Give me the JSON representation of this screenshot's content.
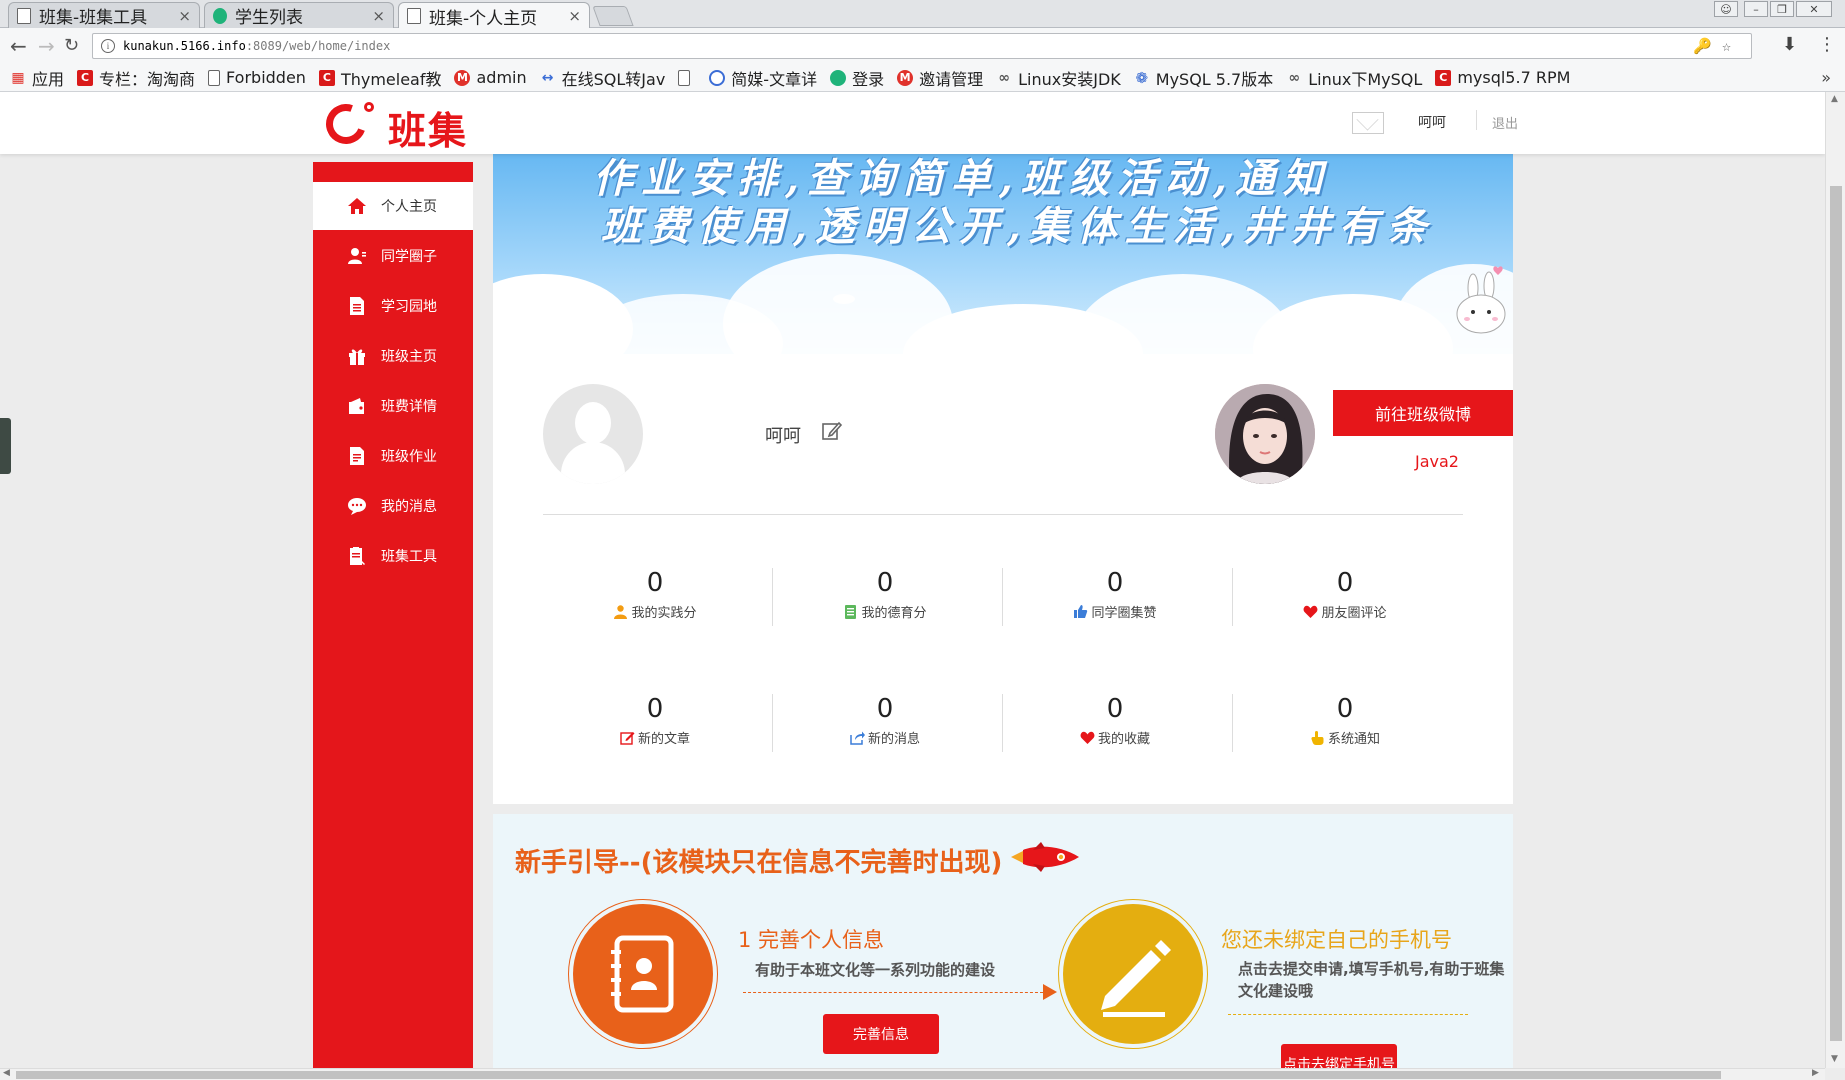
{
  "browser": {
    "tabs": [
      {
        "title": "班集-班集工具",
        "close": "×",
        "active": false
      },
      {
        "title": "学生列表",
        "close": "×",
        "active": false
      },
      {
        "title": "班集-个人主页",
        "close": "×",
        "active": true
      }
    ],
    "url_host": "kunakun.5166.info",
    "url_path": ":8089/web/home/index",
    "bookmarks": [
      {
        "label": "应用",
        "icon": "apps-grid-icon"
      },
      {
        "label": "专栏：淘淘商",
        "icon": "csdn-icon"
      },
      {
        "label": "Forbidden",
        "icon": "page-icon"
      },
      {
        "label": "Thymeleaf教",
        "icon": "csdn-icon"
      },
      {
        "label": "admin",
        "icon": "m-icon"
      },
      {
        "label": "在线SQL转Jav",
        "icon": "code-icon"
      },
      {
        "label": "",
        "icon": "page-icon"
      },
      {
        "label": "简媒-文章详",
        "icon": "blue-icon"
      },
      {
        "label": "登录",
        "icon": "vue-icon"
      },
      {
        "label": "邀请管理",
        "icon": "m-icon"
      },
      {
        "label": "Linux安装JDK",
        "icon": "link-icon"
      },
      {
        "label": "MySQL 5.7版本",
        "icon": "baidu-paw-icon"
      },
      {
        "label": "Linux下MySQL",
        "icon": "link-icon"
      },
      {
        "label": "mysql5.7 RPM",
        "icon": "csdn-icon"
      }
    ],
    "bookmarks_more": "»"
  },
  "header": {
    "logo_text": "班集",
    "username": "呵呵",
    "logout": "退出"
  },
  "sidebar": {
    "items": [
      {
        "label": "个人主页",
        "icon": "home-icon",
        "active": true
      },
      {
        "label": "同学圈子",
        "icon": "user-circle-icon",
        "active": false
      },
      {
        "label": "学习园地",
        "icon": "document-icon",
        "active": false
      },
      {
        "label": "班级主页",
        "icon": "gift-icon",
        "active": false
      },
      {
        "label": "班费详情",
        "icon": "wallet-icon",
        "active": false
      },
      {
        "label": "班级作业",
        "icon": "homework-icon",
        "active": false
      },
      {
        "label": "我的消息",
        "icon": "chat-bubble-icon",
        "active": false
      },
      {
        "label": "班集工具",
        "icon": "tools-icon",
        "active": false
      }
    ]
  },
  "banner": {
    "line1": "作业安排,查询简单,班级活动,通知",
    "line2": "班费使用,透明公开,集体生活,井井有条"
  },
  "profile": {
    "username": "呵呵",
    "weibo_button": "前往班级微博",
    "class_name": "Java2"
  },
  "stats": [
    {
      "value": "0",
      "label": "我的实践分",
      "icon": "person-icon",
      "color": "#f39c12"
    },
    {
      "value": "0",
      "label": "我的德育分",
      "icon": "doc-list-icon",
      "color": "#5cb85c"
    },
    {
      "value": "0",
      "label": "同学圈集赞",
      "icon": "thumbs-up-icon",
      "color": "#3b7dd8"
    },
    {
      "value": "0",
      "label": "朋友圈评论",
      "icon": "heart-icon",
      "color": "#e6161a"
    },
    {
      "value": "0",
      "label": "新的文章",
      "icon": "edit-square-icon",
      "color": "#e6161a"
    },
    {
      "value": "0",
      "label": "新的消息",
      "icon": "share-icon",
      "color": "#3b7dd8"
    },
    {
      "value": "0",
      "label": "我的收藏",
      "icon": "heart-icon",
      "color": "#e6161a"
    },
    {
      "value": "0",
      "label": "系统通知",
      "icon": "hand-point-icon",
      "color": "#f0b400"
    }
  ],
  "guide": {
    "title": "新手引导--(该模块只在信息不完善时出现)",
    "step1_title": "1 完善个人信息",
    "step1_desc": "有助于本班文化等一系列功能的建设",
    "step1_button": "完善信息",
    "step2_title": "您还未绑定自己的手机号",
    "step2_desc": "点击去提交申请,填写手机号,有助于班集文化建设哦",
    "step2_button": "点击去绑定手机号"
  },
  "colors": {
    "brand_red": "#e6161a",
    "guide_orange": "#e8611a",
    "guide_yellow": "#e8a51a"
  }
}
